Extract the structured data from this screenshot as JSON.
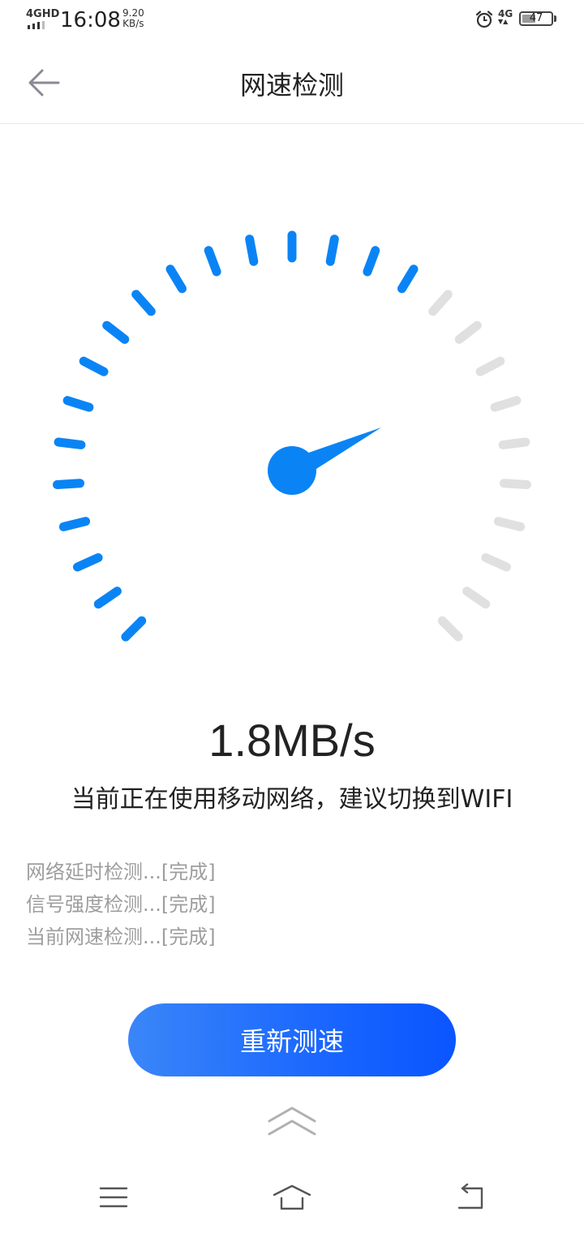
{
  "status_bar": {
    "network_type": "4GHD",
    "time": "16:08",
    "speed_value": "9.20",
    "speed_unit": "KB/s",
    "mobile_data": "4G",
    "battery": "47",
    "icons": [
      "signal-icon",
      "alarm-icon",
      "battery-icon"
    ]
  },
  "header": {
    "title": "网速检测",
    "back_icon": "arrow-left-icon"
  },
  "gauge": {
    "total_ticks": 27,
    "active_ticks": 17,
    "active_color": "#0a84f5",
    "inactive_color": "#e0e0e0",
    "needle_color": "#0a84f5"
  },
  "result": {
    "speed": "1.8MB/s",
    "advice": "当前正在使用移动网络，建议切换到WIFI"
  },
  "steps": [
    {
      "label": "网络延时检测...[完成]"
    },
    {
      "label": "信号强度检测...[完成]"
    },
    {
      "label": "当前网速检测...[完成]"
    }
  ],
  "actions": {
    "retest_label": "重新测速",
    "swipe_icon": "double-chevron-up-icon"
  },
  "nav_bar": {
    "icons": [
      "menu-icon",
      "home-icon",
      "back-icon"
    ]
  },
  "colors": {
    "accent": "#0a84f5",
    "button_gradient_start": "#3a86f8",
    "button_gradient_end": "#0a55ff",
    "muted_text": "#9e9e9e"
  }
}
